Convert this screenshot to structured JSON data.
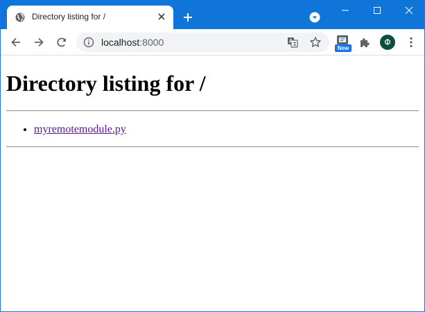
{
  "browser": {
    "tab": {
      "title": "Directory listing for /",
      "favicon": "globe-icon"
    },
    "window_controls": [
      "minimize-icon",
      "maximize-icon",
      "close-icon"
    ],
    "address_bar": {
      "host": "localhost",
      "port": ":8000"
    },
    "extension_badge": "New",
    "avatar_letter": "Φ",
    "accent_color": "#0f75d8"
  },
  "page": {
    "heading": "Directory listing for /",
    "files": [
      {
        "name": "myremotemodule.py"
      }
    ]
  }
}
